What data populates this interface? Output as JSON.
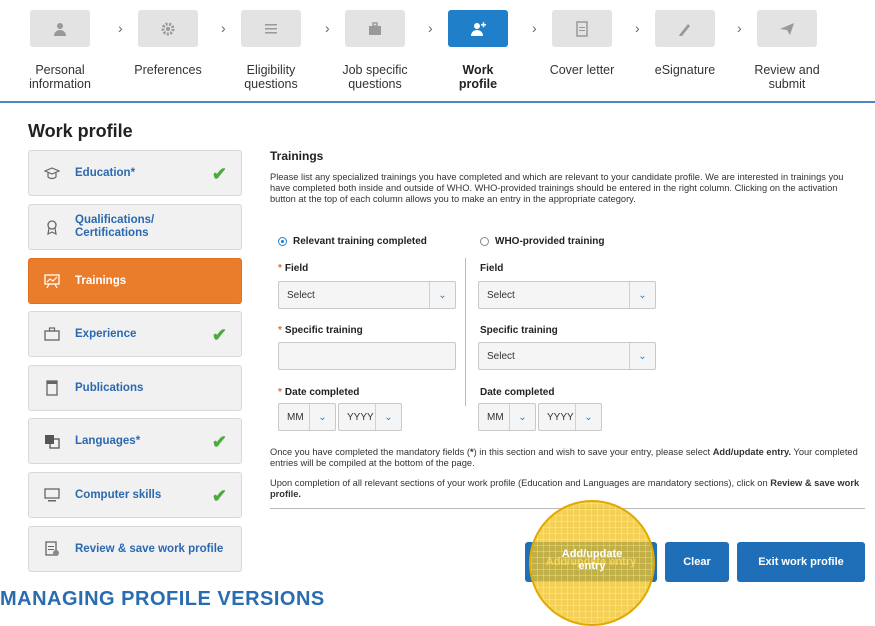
{
  "stepper": {
    "steps": [
      {
        "label": "Personal\ninformation",
        "icon": "person-icon"
      },
      {
        "label": "Preferences",
        "icon": "gear-icon"
      },
      {
        "label": "Eligibility\nquestions",
        "icon": "list-icon"
      },
      {
        "label": "Job specific\nquestions",
        "icon": "briefcase-icon"
      },
      {
        "label": "Work\nprofile",
        "icon": "add-user-icon",
        "active": true
      },
      {
        "label": "Cover letter",
        "icon": "document-icon"
      },
      {
        "label": "eSignature",
        "icon": "pencil-icon"
      },
      {
        "label": "Review and\nsubmit",
        "icon": "send-icon"
      }
    ]
  },
  "page_title": "Work profile",
  "sidebar": {
    "items": [
      {
        "label": "Education*",
        "icon": "graduation-cap-icon",
        "checked": true
      },
      {
        "label": "Qualifications/\nCertifications",
        "icon": "award-icon",
        "checked": false
      },
      {
        "label": "Trainings",
        "icon": "presentation-icon",
        "checked": false,
        "active": true
      },
      {
        "label": "Experience",
        "icon": "briefcase-icon",
        "checked": true
      },
      {
        "label": "Publications",
        "icon": "book-icon",
        "checked": false
      },
      {
        "label": "Languages*",
        "icon": "language-icon",
        "checked": true
      },
      {
        "label": "Computer skills",
        "icon": "computer-icon",
        "checked": true
      },
      {
        "label": "Review & save work profile",
        "icon": "review-icon",
        "checked": false
      }
    ],
    "check_glyph": "✔"
  },
  "main": {
    "section_title": "Trainings",
    "description": "Please list any specialized trainings you have completed and which are relevant to your candidate profile. We are interested in trainings you have completed both inside and outside of WHO. WHO-provided trainings should be entered in the right column. Clicking on the activation button at the top of each column allows you to make an entry in the appropriate category.",
    "left": {
      "radio_label": "Relevant training completed",
      "field_label": "Field",
      "field_value": "Select",
      "specific_label": "Specific training",
      "specific_value": "",
      "date_label": "Date completed",
      "month_value": "MM",
      "year_value": "YYYY"
    },
    "right": {
      "radio_label": "WHO-provided training",
      "field_label": "Field",
      "field_value": "Select",
      "specific_label": "Specific training",
      "specific_value": "Select",
      "date_label": "Date completed",
      "month_value": "MM",
      "year_value": "YYYY"
    },
    "required_marker": "*",
    "note1_a": "Once you have completed the mandatory fields (",
    "note1_b": "*",
    "note1_c": ") in this section and wish to save your entry, please select ",
    "note1_d": "Add/update entry.",
    "note1_e": " Your completed entries will be compiled at the bottom of the page.",
    "note2_a": "Upon completion of all relevant sections of your work profile (Education and Languages are mandatory sections), click on ",
    "note2_b": "Review & save work profile.",
    "buttons": {
      "add": "Add/update\nentry",
      "clear": "Clear",
      "exit": "Exit work profile"
    }
  },
  "bottom_heading": "MANAGING PROFILE VERSIONS",
  "colors": {
    "accent": "#1f7fc8",
    "active_sidebar": "#ea7d2c",
    "check": "#4caa3e",
    "highlight": "#f0c328"
  }
}
